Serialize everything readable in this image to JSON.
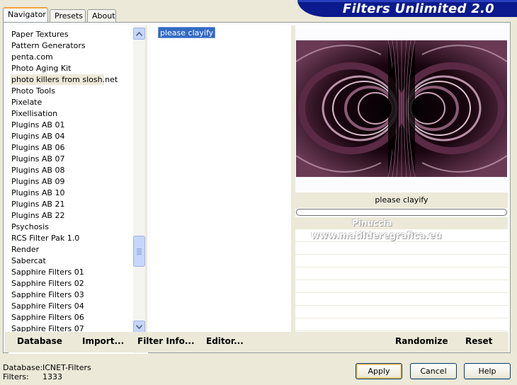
{
  "app": {
    "title": "Filters Unlimited 2.0"
  },
  "tabs": [
    {
      "label": "Navigator",
      "active": true
    },
    {
      "label": "Presets",
      "active": false
    },
    {
      "label": "About",
      "active": false
    }
  ],
  "categories": {
    "selected": "photo killers from slosh.net",
    "items": [
      "Paper Textures",
      "Pattern Generators",
      "penta.com",
      "Photo Aging Kit",
      "photo killers from slosh.net",
      "Photo Tools",
      "Pixelate",
      "Pixellisation",
      "Plugins AB 01",
      "Plugins AB 04",
      "Plugins AB 06",
      "Plugins AB 07",
      "Plugins AB 08",
      "Plugins AB 09",
      "Plugins AB 10",
      "Plugins AB 21",
      "Plugins AB 22",
      "Psychosis",
      "RCS Filter Pak 1.0",
      "Render",
      "Sabercat",
      "Sapphire Filters 01",
      "Sapphire Filters 02",
      "Sapphire Filters 03",
      "Sapphire Filters 04",
      "Sapphire Filters 06",
      "Sapphire Filters 07"
    ]
  },
  "filters": {
    "items": [
      "please clayify"
    ],
    "selected": "please clayify"
  },
  "preview": {
    "filter_name": "please clayify",
    "watermark_line1": "Pinuccia",
    "watermark_line2": "www.matilderegrafica.eu",
    "colors": {
      "dark": "#000000",
      "ring": "#c8a0b8",
      "deep": "#3a1028"
    }
  },
  "bottom_buttons": {
    "database": "Database",
    "import": "Import...",
    "filter_info": "Filter Info...",
    "editor": "Editor...",
    "randomize": "Randomize",
    "reset": "Reset"
  },
  "footer": {
    "database_label": "Database:",
    "database_value": "ICNET-Filters",
    "filters_label": "Filters:",
    "filters_value": "1333",
    "apply": "Apply",
    "cancel": "Cancel",
    "help": "Help"
  }
}
